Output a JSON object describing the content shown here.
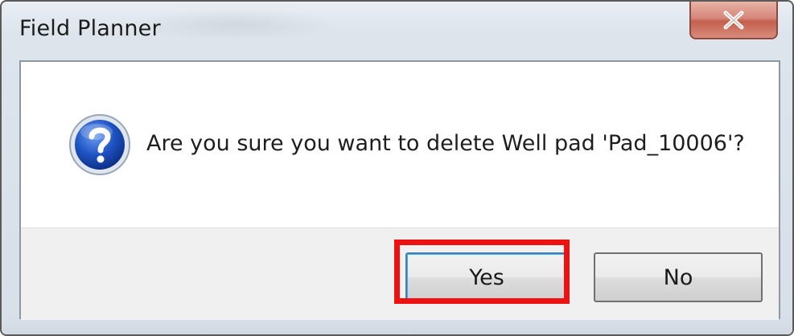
{
  "window": {
    "title": "Field Planner",
    "close_icon": "close-icon"
  },
  "dialog": {
    "icon": "question-icon",
    "message": "Are you sure you want to delete Well pad 'Pad_10006'?"
  },
  "buttons": {
    "yes_label": "Yes",
    "no_label": "No"
  },
  "annotation": {
    "highlight_color": "#ee1111"
  }
}
